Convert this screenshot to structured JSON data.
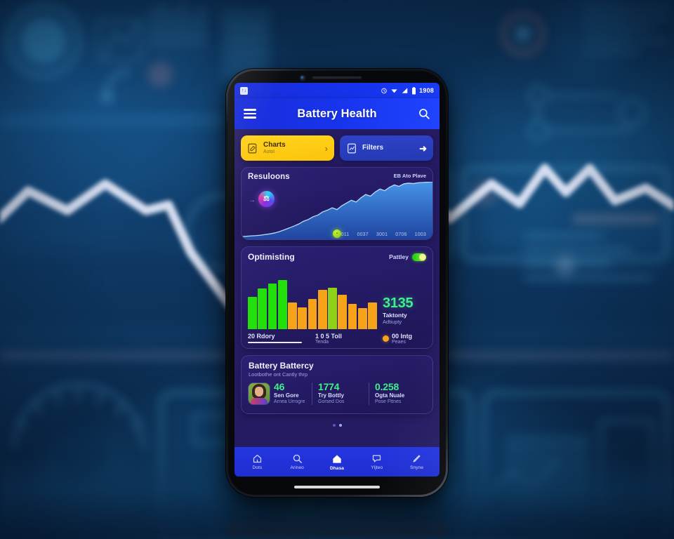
{
  "background": {
    "description": "blurred blue technology infographic with white zigzag trend line",
    "accent_blue": "#1b6ba8",
    "deep_blue": "#0b2a4b",
    "line_color": "#e8ecfb"
  },
  "device": {
    "frame_color": "#16181c",
    "screen_bg": "#241b63"
  },
  "statusbar": {
    "badge_glyph": "↑↓",
    "time": "1908",
    "icons": [
      "alarm-icon",
      "wifi-icon",
      "signal-icon",
      "battery-icon"
    ]
  },
  "appbar": {
    "title": "Battery Health",
    "menu_icon": "hamburger-icon",
    "search_icon": "search-icon",
    "bg_color": "#1734ec"
  },
  "actions": [
    {
      "id": "primary",
      "icon": "document-edit-icon",
      "label": "Charts",
      "sublabel": "Autol",
      "arrow": "›",
      "color": "#ffd21a"
    },
    {
      "id": "secondary",
      "icon": "report-icon",
      "label": "Filters",
      "sublabel": "",
      "arrow": "➜",
      "color": "#2e43c8"
    }
  ],
  "chart_card": {
    "title": "Resuloons",
    "badge": "EB Ato Plave",
    "avatar_glyph": "⚖",
    "leading_arrow": "→",
    "marker_label": "•",
    "x_labels": [
      "2011",
      "0037",
      "3001",
      "0706",
      "1003"
    ]
  },
  "bars_card": {
    "title": "Optimisting",
    "toggle_label": "Pattley",
    "toggle_state": "on",
    "value": "3135",
    "caption_1": "Taktonty",
    "caption_2": "Adtiupty",
    "foot_left_main": "20 Rdory",
    "foot_left_sub": "",
    "foot_mid_main": "1 0 5 Toll",
    "foot_mid_sub": "Tenda",
    "legend_label": "00 Intg",
    "legend_sub": "Peaes",
    "legend_color": "#f7a31a"
  },
  "stats_card": {
    "title": "Battery Battercy",
    "subtitle": "Lootbothe ont Cantly thrp",
    "items": [
      {
        "value": "46",
        "label1": "Sen Gore",
        "label2": "Arnea Urrogre",
        "color": "#3ff08a",
        "has_avatar": true
      },
      {
        "value": "1774",
        "label1": "Try Bottly",
        "label2": "Gorsed Dos",
        "color": "#3ff08a",
        "has_avatar": false
      },
      {
        "value": "0.258",
        "label1": "Ogta Nuale",
        "label2": "Pose Fttnes",
        "color": "#3ff08a",
        "has_avatar": false
      }
    ]
  },
  "pager": {
    "dots": 2,
    "active_index": 1
  },
  "bottomnav": {
    "items": [
      {
        "icon": "home-outline-icon",
        "label": "Dots",
        "active": false
      },
      {
        "icon": "search-icon",
        "label": "Arineo",
        "active": false
      },
      {
        "icon": "home-filled-icon",
        "label": "Dhasa",
        "active": true
      },
      {
        "icon": "chat-icon",
        "label": "Yljteo",
        "active": false
      },
      {
        "icon": "pencil-icon",
        "label": "Snyne",
        "active": false
      }
    ]
  },
  "chart_data": [
    {
      "type": "area",
      "title": "Resuloons",
      "xlabel": "",
      "ylabel": "",
      "x": [
        0,
        1,
        2,
        3,
        4,
        5,
        6,
        7,
        8,
        9,
        10,
        11,
        12,
        13,
        14,
        15,
        16,
        17,
        18,
        19,
        20,
        21,
        22,
        23,
        24,
        25,
        26,
        27,
        28,
        29,
        30,
        31,
        32,
        33,
        34,
        35,
        36,
        37,
        38,
        39,
        40
      ],
      "values": [
        4,
        4,
        5,
        5,
        6,
        7,
        8,
        9,
        11,
        13,
        15,
        17,
        19,
        22,
        24,
        27,
        29,
        33,
        35,
        38,
        36,
        41,
        44,
        47,
        45,
        50,
        54,
        52,
        57,
        61,
        59,
        64,
        68,
        66,
        70,
        72,
        71,
        76,
        80,
        84,
        88
      ],
      "ylim": [
        0,
        100
      ],
      "grid": false,
      "legend": "none",
      "tick_labels": [
        "2011",
        "0037",
        "3001",
        "0706",
        "1003"
      ],
      "series_color": "#2f7fe0",
      "line_color": "#9fd2ff"
    },
    {
      "type": "bar",
      "title": "Optimisting",
      "categories": [
        "1",
        "2",
        "3",
        "4",
        "5",
        "6",
        "7",
        "8",
        "9",
        "10",
        "11",
        "12",
        "13"
      ],
      "values": [
        62,
        78,
        88,
        95,
        52,
        42,
        58,
        76,
        80,
        66,
        48,
        40,
        52
      ],
      "bar_colors": [
        "#22e00a",
        "#22e00a",
        "#22e00a",
        "#22e00a",
        "#f7a31a",
        "#f7a31a",
        "#f7a31a",
        "#f7a31a",
        "#8fd119",
        "#f7a31a",
        "#f7a31a",
        "#f7a31a",
        "#f7a31a"
      ],
      "ylim": [
        0,
        100
      ],
      "grid": false,
      "ylabel": "",
      "xlabel": "",
      "legend": "bottom-right",
      "legend_entries": [
        "00 Intg"
      ],
      "highlight_value": "3135"
    }
  ]
}
